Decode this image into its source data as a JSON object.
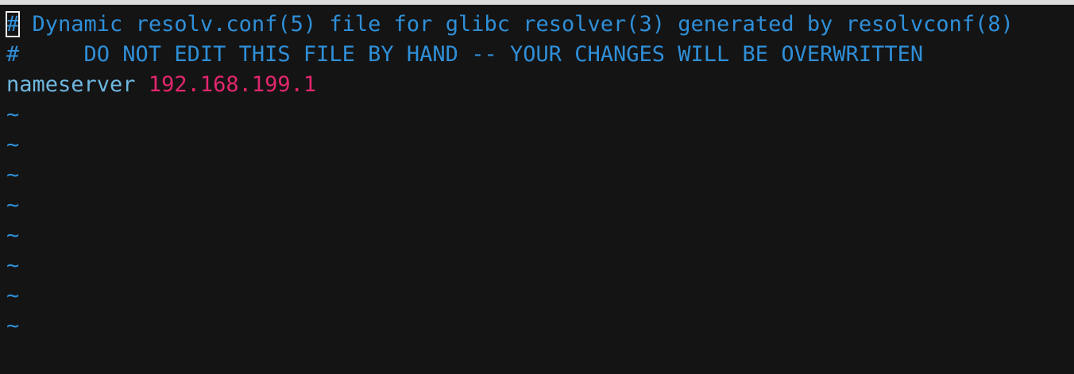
{
  "editor": {
    "line1": {
      "cursor_char": "#",
      "rest": " Dynamic resolv.conf(5) file for glibc resolver(3) generated by resolvconf(8)"
    },
    "line2": "#     DO NOT EDIT THIS FILE BY HAND -- YOUR CHANGES WILL BE OVERWRITTEN",
    "line3": {
      "keyword": "nameserver",
      "value": "192.168.199.1"
    },
    "empty_marker": "~",
    "empty_lines": 8
  },
  "colors": {
    "background": "#141414",
    "comment": "#2f8fd8",
    "keyword": "#6fb7e0",
    "number": "#e3266e",
    "cursor": "#f2f2f2"
  }
}
